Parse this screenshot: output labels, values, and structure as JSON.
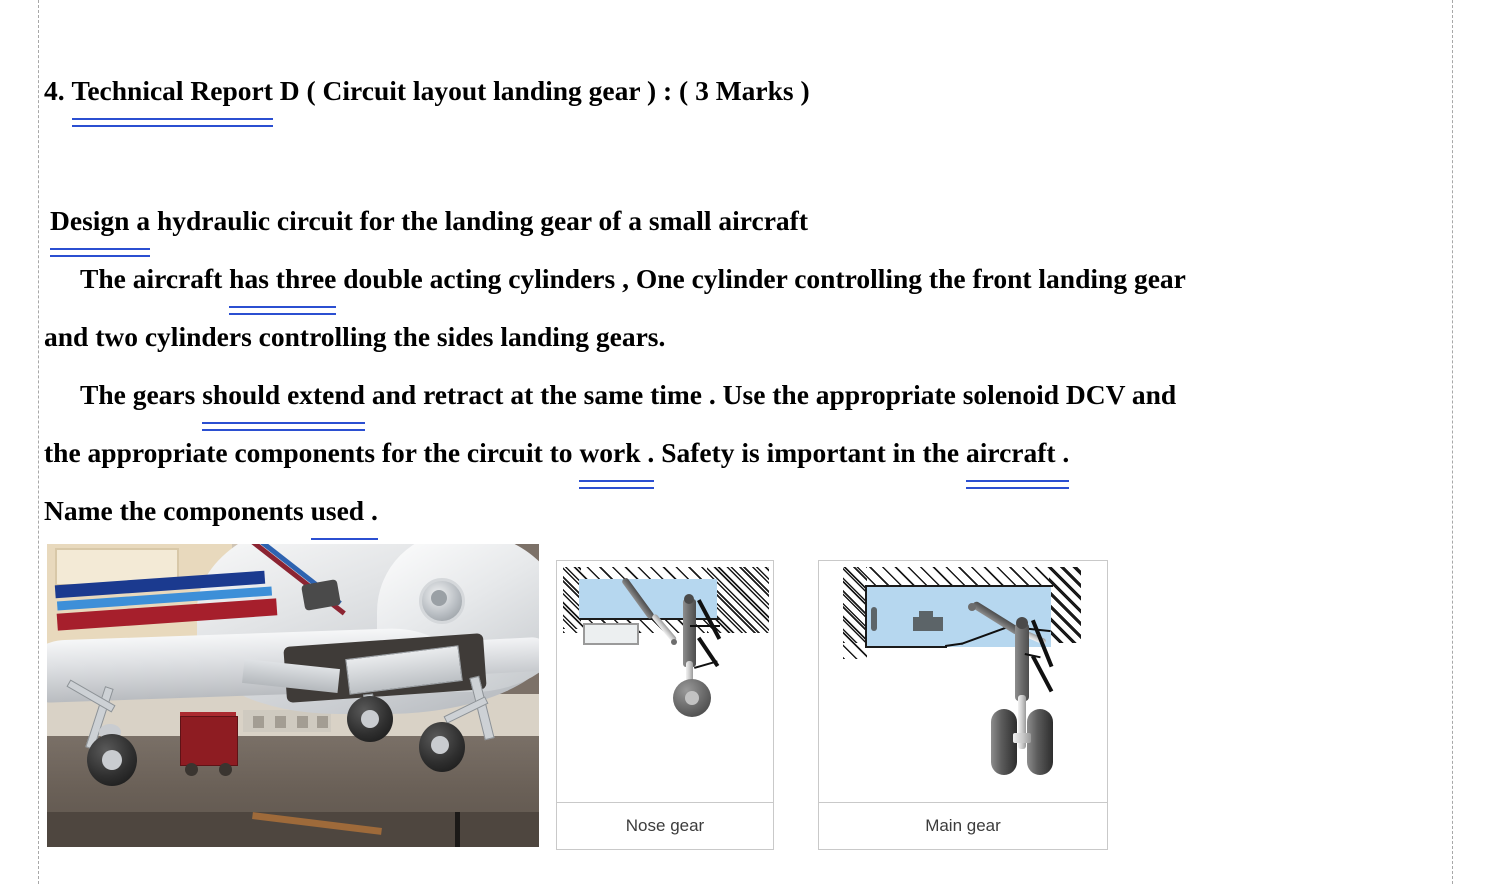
{
  "document": {
    "heading": {
      "number": "4.",
      "title_underlined": "Technical  Report",
      "rest": "D   ( Circuit layout  landing gear ) : ( 3 Marks )"
    },
    "paragraphs": {
      "p1_underlined": "Design  a",
      "p1_rest": "hydraulic circuit  for  the landing gear of a small aircraft",
      "p2_a": "The aircraft",
      "p2_underlined": "has  three",
      "p2_b": "double acting cylinders  , One cylinder controlling the front landing gear",
      "p3": "and two cylinders controlling the sides landing gears.",
      "p4_a": "The gears",
      "p4_underlined": "should  extend",
      "p4_b": "and retract at the same time . Use the appropriate solenoid DCV and",
      "p5_a": "the appropriate components for the circuit to",
      "p5_underlined": "work .",
      "p5_b": "Safety is important in the",
      "p5_underlined2": "aircraft .",
      "p6_a": "Name the components",
      "p6_underlined": "used ."
    },
    "underline_color": "#2b4fd1",
    "text_color": "#000000"
  },
  "figures": {
    "photo": {
      "alt": "Small aircraft in hangar with landing gear extended"
    },
    "nose_gear": {
      "label": "Nose gear"
    },
    "main_gear": {
      "label": "Main gear"
    },
    "bay_color": "#b6d7ef",
    "border_color": "#c9c9c9"
  },
  "page": {
    "margin_guide_color": "#a8a8a8"
  }
}
